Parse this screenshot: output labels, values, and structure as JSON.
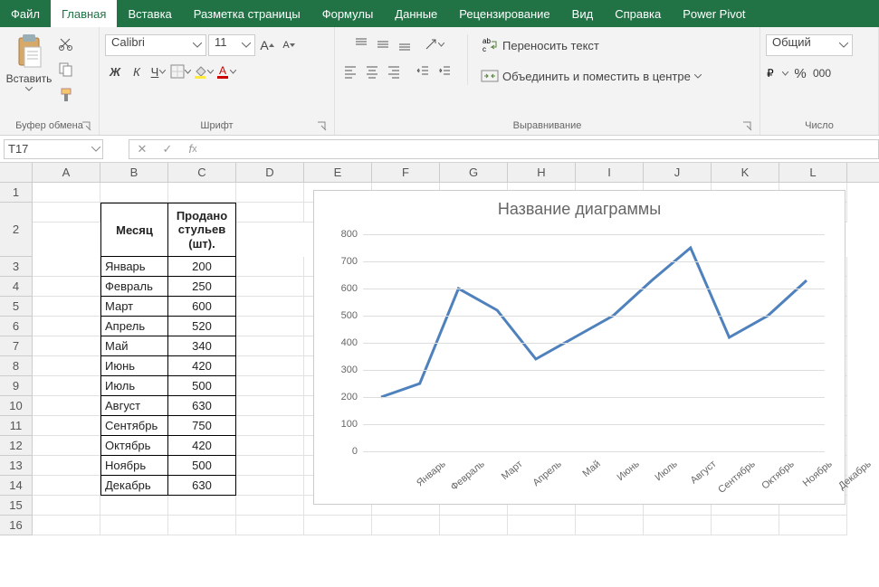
{
  "tabs": [
    "Файл",
    "Главная",
    "Вставка",
    "Разметка страницы",
    "Формулы",
    "Данные",
    "Рецензирование",
    "Вид",
    "Справка",
    "Power Pivot"
  ],
  "active_tab": 1,
  "ribbon": {
    "paste": "Вставить",
    "clipboard_label": "Буфер обмена",
    "font_name": "Calibri",
    "font_size": "11",
    "font_group": "Шрифт",
    "bold": "Ж",
    "italic": "К",
    "underline": "Ч",
    "align_group": "Выравнивание",
    "wrap_text": "Переносить текст",
    "merge_center": "Объединить и поместить в центре",
    "number_format": "Общий",
    "number_group": "Число"
  },
  "formula_bar": {
    "cell_ref": "T17",
    "formula": ""
  },
  "columns": [
    "A",
    "B",
    "C",
    "D",
    "E",
    "F",
    "G",
    "H",
    "I",
    "J",
    "K",
    "L"
  ],
  "row_count": 16,
  "table": {
    "headers": {
      "b": "Месяц",
      "c": "Продано стульев (шт)."
    },
    "rows": [
      {
        "b": "Январь",
        "c": "200"
      },
      {
        "b": "Февраль",
        "c": "250"
      },
      {
        "b": "Март",
        "c": "600"
      },
      {
        "b": "Апрель",
        "c": "520"
      },
      {
        "b": "Май",
        "c": "340"
      },
      {
        "b": "Июнь",
        "c": "420"
      },
      {
        "b": "Июль",
        "c": "500"
      },
      {
        "b": "Август",
        "c": "630"
      },
      {
        "b": "Сентябрь",
        "c": "750"
      },
      {
        "b": "Октябрь",
        "c": "420"
      },
      {
        "b": "Ноябрь",
        "c": "500"
      },
      {
        "b": "Декабрь",
        "c": "630"
      }
    ]
  },
  "chart_data": {
    "type": "line",
    "title": "Название диаграммы",
    "categories": [
      "Январь",
      "Февраль",
      "Март",
      "Апрель",
      "Май",
      "Июнь",
      "Июль",
      "Август",
      "Сентябрь",
      "Октябрь",
      "Ноябрь",
      "Декабрь"
    ],
    "values": [
      200,
      250,
      600,
      520,
      340,
      420,
      500,
      630,
      750,
      420,
      500,
      630
    ],
    "ylim": [
      0,
      800
    ],
    "yticks": [
      0,
      100,
      200,
      300,
      400,
      500,
      600,
      700,
      800
    ],
    "xlabel": "",
    "ylabel": ""
  }
}
